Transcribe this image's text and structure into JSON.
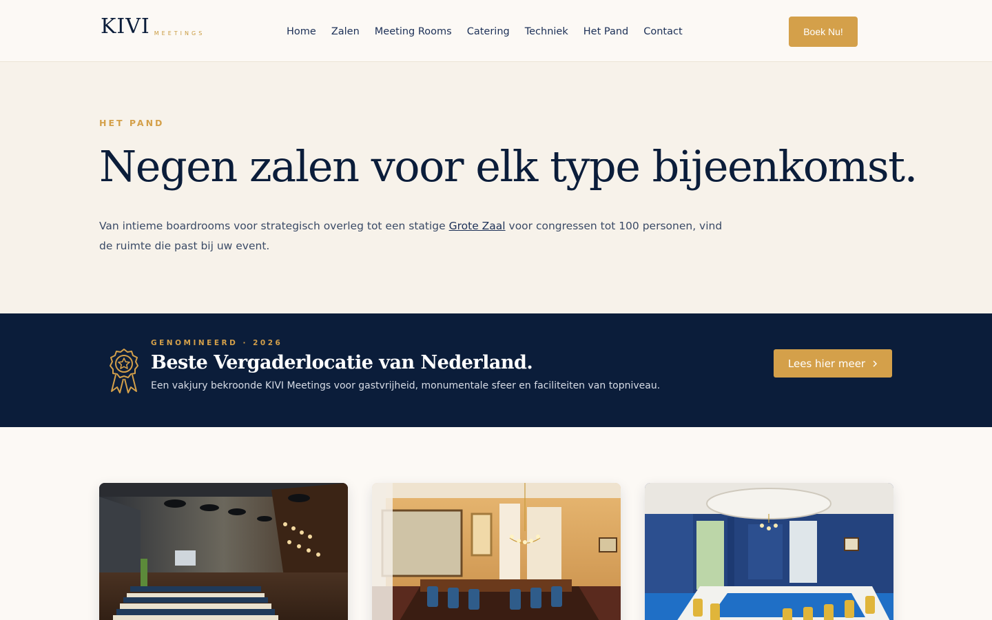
{
  "header": {
    "logo": {
      "main": "KIVI",
      "sub": "MEETINGS"
    },
    "nav": [
      "Home",
      "Zalen",
      "Meeting Rooms",
      "Catering",
      "Techniek",
      "Het Pand",
      "Contact"
    ],
    "cta_label": "Boek Nu!"
  },
  "hero": {
    "eyebrow": "HET PAND",
    "title": "Negen zalen voor elk type bijeenkomst.",
    "text_before": "Van intieme boardrooms voor strategisch overleg tot een statige ",
    "link_label": "Grote Zaal",
    "text_after": " voor congressen tot 100 personen, vind de ruimte die past bij uw event."
  },
  "award": {
    "icon": "award-ribbon-icon",
    "eyebrow": "GENOMINEERD · 2026",
    "title": "Beste Vergaderlocatie van Nederland.",
    "text": "Een vakjury bekroonde KIVI Meetings voor gastvrijheid, monumentale sfeer en faciliteiten van topniveau.",
    "button_label": "Lees hier meer",
    "button_icon": "chevron-right-icon"
  },
  "cards": [
    {
      "image": "conference-hall-photo"
    },
    {
      "image": "boardroom-chandelier-photo"
    },
    {
      "image": "blue-meeting-room-photo"
    }
  ],
  "colors": {
    "navy": "#0b1d3a",
    "gold": "#d4a04a",
    "cream": "#f7f2ea",
    "page": "#fcf9f5"
  }
}
